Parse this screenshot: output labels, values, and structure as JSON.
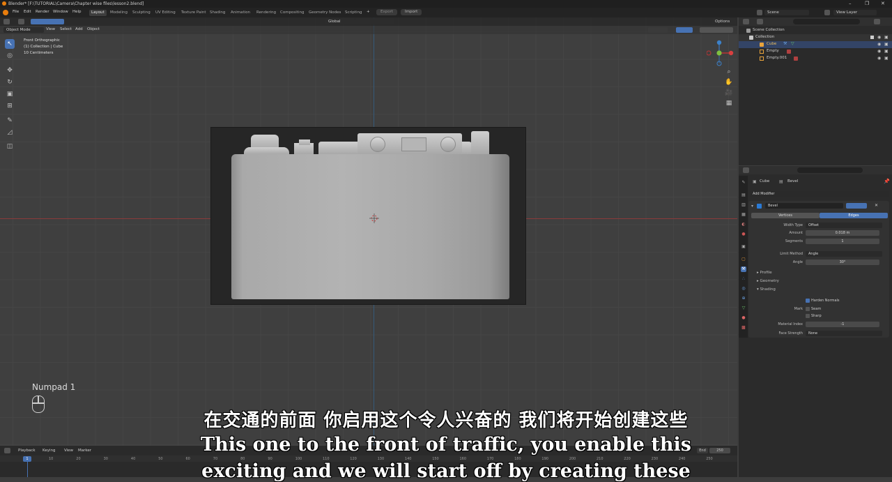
{
  "window": {
    "title": "Blender* [F:\\TUTORIAL\\Camera\\Chapter wise files\\lesson2.blend]",
    "controls": [
      "–",
      "❐",
      "✕"
    ]
  },
  "menubar": {
    "menus": [
      "File",
      "Edit",
      "Render",
      "Window",
      "Help"
    ],
    "workspaces": [
      "Layout",
      "Modeling",
      "Sculpting",
      "UV Editing",
      "Texture Paint",
      "Shading",
      "Animation",
      "Rendering",
      "Compositing",
      "Geometry Nodes",
      "Scripting"
    ],
    "active_workspace": "Layout",
    "add_tab": "+",
    "export_label": "Export",
    "import_label": "Import",
    "scene": "Scene",
    "view_layer": "View Layer"
  },
  "viewport": {
    "mode": "Object Mode",
    "menus": [
      "View",
      "Select",
      "Add",
      "Object"
    ],
    "orientation": "Global",
    "options_label": "Options",
    "overlay_lines": [
      "Front Orthographic",
      "(1) Collection | Cube",
      "10 Centimeters"
    ],
    "key_hint": "Numpad 1"
  },
  "outliner": {
    "root": "Scene Collection",
    "collection": "Collection",
    "items": [
      "Cube",
      "Empty",
      "Empty.001"
    ]
  },
  "properties": {
    "object_name": "Cube",
    "modifier_name_crumb": "Bevel",
    "add_modifier": "Add Modifier",
    "modifier": "Bevel",
    "affect_tabs": [
      "Vertices",
      "Edges"
    ],
    "active_affect": "Edges",
    "fields": {
      "width_type_label": "Width Type",
      "width_type": "Offset",
      "amount_label": "Amount",
      "amount": "0.018 m",
      "segments_label": "Segments",
      "segments": "1",
      "limit_method_label": "Limit Method",
      "limit_method": "Angle",
      "angle_label": "Angle",
      "angle": "30°"
    },
    "panels": [
      "Profile",
      "Geometry",
      "Shading"
    ],
    "shading": {
      "harden_normals": "Harden Normals",
      "mark_label": "Mark",
      "seam": "Seam",
      "sharp": "Sharp",
      "material_index_label": "Material Index",
      "material_index": "-1",
      "face_strength_label": "Face Strength",
      "face_strength": "None"
    }
  },
  "timeline": {
    "menus": [
      "Playback",
      "Keying",
      "View",
      "Marker"
    ],
    "current_frame": "1",
    "ticks": [
      "10",
      "20",
      "30",
      "40",
      "50",
      "60",
      "70",
      "80",
      "90",
      "100",
      "110",
      "120",
      "130",
      "140",
      "150",
      "160",
      "170",
      "180",
      "190",
      "200",
      "210",
      "220",
      "230",
      "240",
      "250"
    ],
    "end_label": "End",
    "end_value": "250"
  },
  "subtitles": {
    "chinese": "在交通的前面 你启用这个令人兴奋的 我们将开始创建这些",
    "english_line1": "This one to the front of traffic, you enable this",
    "english_line2": "exciting and we will start off by creating these"
  },
  "colors": {
    "accent": "#4772b3",
    "x_axis": "#8a3a3a",
    "y_axis": "#355a7a"
  }
}
